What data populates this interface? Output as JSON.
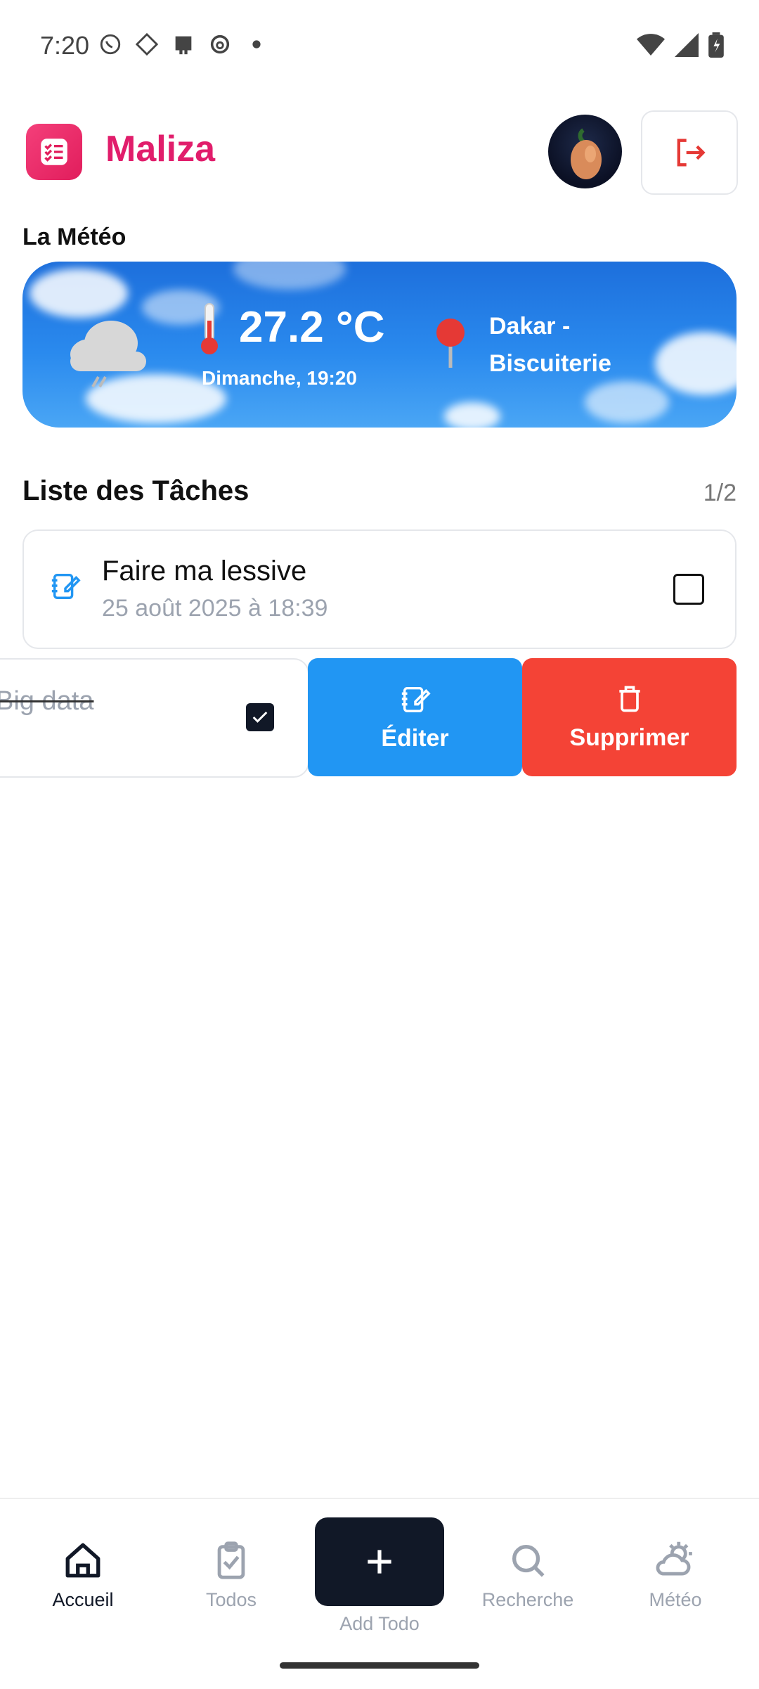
{
  "status_bar": {
    "time": "7:20",
    "left_icons": [
      "whatsapp-icon",
      "app-icon",
      "app-icon",
      "threads-icon",
      "dot-icon"
    ],
    "right_icons": [
      "wifi-icon",
      "signal-icon",
      "battery-icon"
    ]
  },
  "header": {
    "app_name": "Maliza",
    "brand_color": "#e11d6b"
  },
  "weather": {
    "section_title": "La Météo",
    "temperature": "27.2 °C",
    "date_time": "Dimanche, 19:20",
    "location": "Dakar - Biscuiterie"
  },
  "tasks": {
    "section_title": "Liste des Tâches",
    "count": "1/2",
    "items": [
      {
        "title": "Faire ma lessive",
        "date": "25 août 2025 à 18:39",
        "done": false
      },
      {
        "title": "Big data",
        "done": true
      }
    ],
    "actions": {
      "edit": "Éditer",
      "delete": "Supprimer"
    }
  },
  "bottom_nav": {
    "items": [
      {
        "label": "Accueil",
        "icon": "home-icon",
        "active": true
      },
      {
        "label": "Todos",
        "icon": "clipboard-check-icon",
        "active": false
      },
      {
        "label": "Add Todo",
        "icon": "plus-icon",
        "active": false
      },
      {
        "label": "Recherche",
        "icon": "search-icon",
        "active": false
      },
      {
        "label": "Météo",
        "icon": "weather-icon",
        "active": false
      }
    ]
  },
  "colors": {
    "edit": "#2196f3",
    "delete": "#f44336",
    "nav_dark": "#111827"
  }
}
